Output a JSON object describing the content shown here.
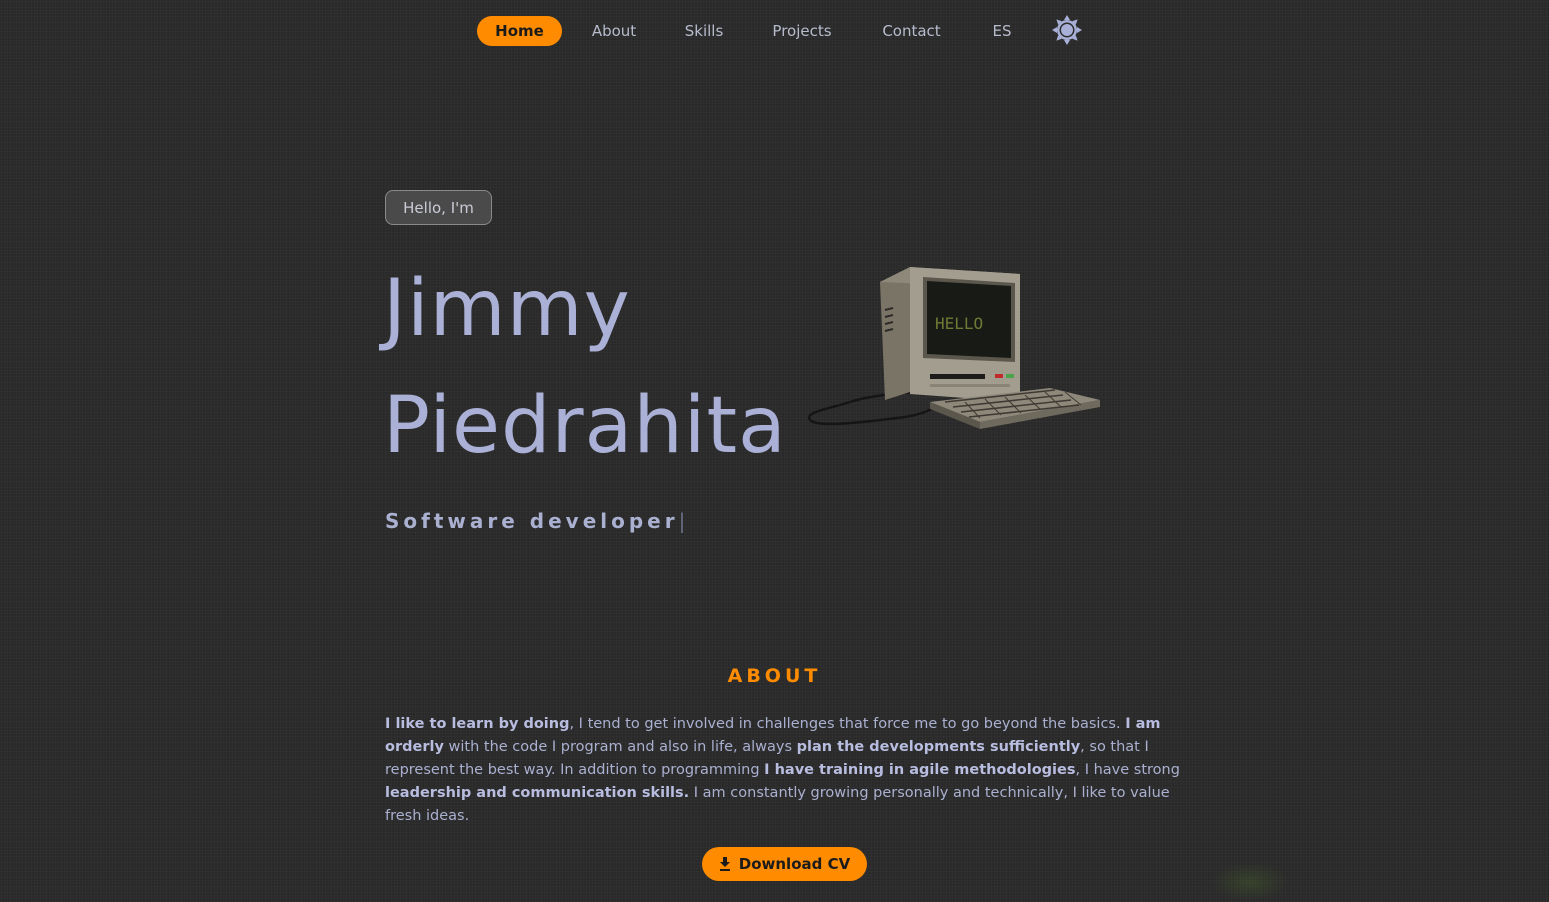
{
  "nav": {
    "items": [
      {
        "label": "Home",
        "active": true
      },
      {
        "label": "About"
      },
      {
        "label": "Skills"
      },
      {
        "label": "Projects"
      },
      {
        "label": "Contact"
      },
      {
        "label": "ES"
      }
    ],
    "theme_icon": "sun-icon"
  },
  "hero": {
    "greeting": "Hello, I'm",
    "name_first": "Jimmy",
    "name_last": "Piedrahita",
    "role": "Software developer",
    "cursor": "|",
    "screen_text": "HELLO",
    "illustration_icon": "retro-computer-icon"
  },
  "about": {
    "title": "ABOUT",
    "segments": [
      {
        "text": "I like to learn by doing",
        "bold": true
      },
      {
        "text": ", I tend to get involved in challenges that force me to go beyond the basics. ",
        "bold": false
      },
      {
        "text": "I am orderly",
        "bold": true
      },
      {
        "text": " with the code I program and also in life, always ",
        "bold": false
      },
      {
        "text": "plan the developments sufficiently",
        "bold": true
      },
      {
        "text": ", so that I represent the best way. In addition to programming ",
        "bold": false
      },
      {
        "text": "I have training in agile methodologies",
        "bold": true
      },
      {
        "text": ", I have strong ",
        "bold": false
      },
      {
        "text": "leadership and communication skills.",
        "bold": true
      },
      {
        "text": " I am constantly growing personally and technically, I like to value fresh ideas.",
        "bold": false
      }
    ],
    "button_label": "Download CV",
    "button_icon": "download-icon"
  },
  "colors": {
    "accent": "#ff8c00",
    "background": "#2a2a2a",
    "text": "#aab0d0"
  }
}
